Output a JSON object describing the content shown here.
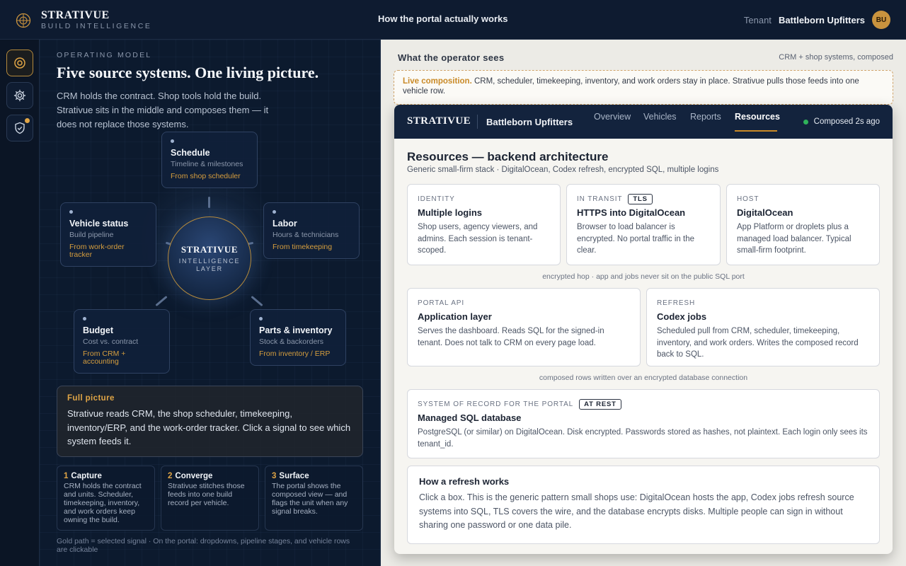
{
  "app": {
    "brand_name": "STRATIVUE",
    "brand_sub": "BUILD INTELLIGENCE",
    "header_center": "How the portal actually works",
    "tenant_label": "Tenant",
    "tenant_name": "Battleborn Upfitters",
    "avatar_initials": "BU"
  },
  "rail": {
    "items": [
      {
        "icon": "target-icon",
        "active": true
      },
      {
        "icon": "gear-icon",
        "active": false
      },
      {
        "icon": "shield-check-icon",
        "active": false,
        "notification": true
      }
    ]
  },
  "left": {
    "eyebrow": "OPERATING MODEL",
    "title": "Five source systems. One living picture.",
    "lead": "CRM holds the contract. Shop tools hold the build. Strativue sits in the middle and composes them — it does not replace those systems.",
    "core": {
      "title": "STRATIVUE",
      "sub": "INTELLIGENCE LAYER"
    },
    "nodes": {
      "schedule": {
        "title": "Schedule",
        "desc": "Timeline & milestones",
        "source": "From shop scheduler"
      },
      "vehicle": {
        "title": "Vehicle status",
        "desc": "Build pipeline",
        "source": "From work-order tracker"
      },
      "labor": {
        "title": "Labor",
        "desc": "Hours & technicians",
        "source": "From timekeeping"
      },
      "budget": {
        "title": "Budget",
        "desc": "Cost vs. contract",
        "source": "From CRM + accounting"
      },
      "parts": {
        "title": "Parts & inventory",
        "desc": "Stock & backorders",
        "source": "From inventory / ERP"
      }
    },
    "full_picture": {
      "heading": "Full picture",
      "body": "Strativue reads CRM, the shop scheduler, timekeeping, inventory/ERP, and the work-order tracker. Click a signal to see which system feeds it."
    },
    "steps": [
      {
        "num": "1",
        "title": "Capture",
        "body": "CRM holds the contract and units. Scheduler, timekeeping, inventory, and work orders keep owning the build."
      },
      {
        "num": "2",
        "title": "Converge",
        "body": "Strativue stitches those feeds into one build record per vehicle."
      },
      {
        "num": "3",
        "title": "Surface",
        "body": "The portal shows the composed view — and flags the unit when any signal breaks."
      }
    ],
    "footnote": "Gold path = selected signal  ·  On the portal: dropdowns, pipeline stages, and vehicle rows are clickable"
  },
  "right": {
    "title": "What the operator sees",
    "subtitle": "CRM + shop systems, composed",
    "live_label": "Live composition.",
    "live_text": "CRM, scheduler, timekeeping, inventory, and work orders stay in place. Strativue pulls those feeds into one vehicle row.",
    "portal": {
      "brand": "STRATIVUE",
      "tenant": "Battleborn Upfitters",
      "tabs": [
        "Overview",
        "Vehicles",
        "Reports",
        "Resources"
      ],
      "active_tab": "Resources",
      "status": "Composed 2s ago",
      "heading": "Resources — backend architecture",
      "subheading": "Generic small-firm stack · DigitalOcean, Codex refresh, encrypted SQL, multiple logins",
      "cards_row1": [
        {
          "kicker": "IDENTITY",
          "badge": "",
          "title": "Multiple logins",
          "desc": "Shop users, agency viewers, and admins. Each session is tenant-scoped."
        },
        {
          "kicker": "IN TRANSIT",
          "badge": "TLS",
          "title": "HTTPS into DigitalOcean",
          "desc": "Browser to load balancer is encrypted. No portal traffic in the clear."
        },
        {
          "kicker": "HOST",
          "badge": "",
          "title": "DigitalOcean",
          "desc": "App Platform or droplets plus a managed load balancer. Typical small-firm footprint."
        }
      ],
      "hop1": "encrypted hop · app and jobs never sit on the public SQL port",
      "cards_row2": [
        {
          "kicker": "PORTAL API",
          "title": "Application layer",
          "desc": "Serves the dashboard. Reads SQL for the signed-in tenant. Does not talk to CRM on every page load."
        },
        {
          "kicker": "REFRESH",
          "title": "Codex jobs",
          "desc": "Scheduled pull from CRM, scheduler, timekeeping, inventory, and work orders. Writes the composed record back to SQL."
        }
      ],
      "hop2": "composed rows written over an encrypted database connection",
      "sql_card": {
        "kicker": "SYSTEM OF RECORD FOR THE PORTAL",
        "badge": "AT REST",
        "title": "Managed SQL database",
        "desc": "PostgreSQL (or similar) on DigitalOcean. Disk encrypted. Passwords stored as hashes, not plaintext. Each login only sees its tenant_id."
      },
      "howto": {
        "title": "How a refresh works",
        "desc": "Click a box. This is the generic pattern small shops use: DigitalOcean hosts the app, Codex jobs refresh source systems into SQL, TLS covers the wire, and the database encrypts disks. Multiple people can sign in without sharing one password or one data pile."
      }
    }
  },
  "colors": {
    "accent_gold": "#c98a27",
    "navy": "#13233d",
    "status_green": "#2fb35a"
  }
}
